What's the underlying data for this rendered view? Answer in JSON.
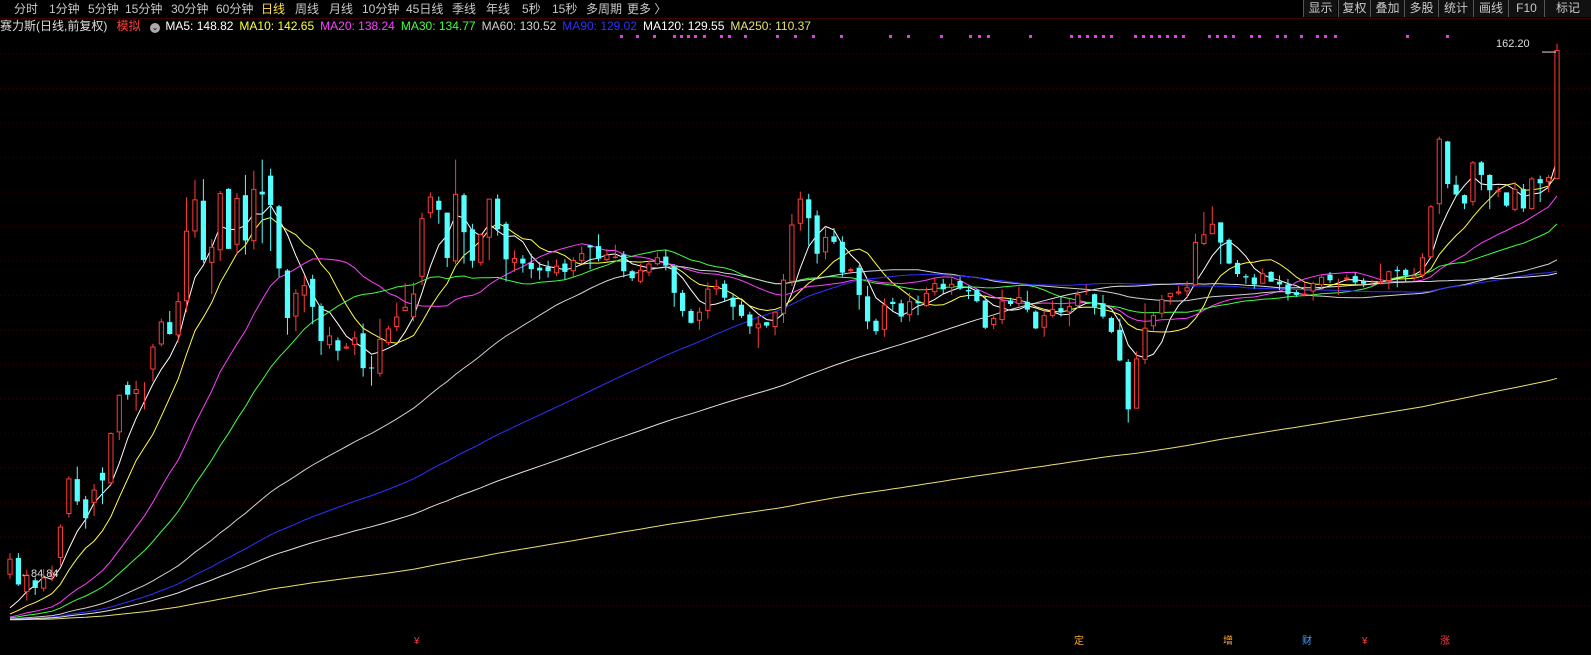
{
  "toolbar": {
    "periods": [
      "分时",
      "1分钟",
      "5分钟",
      "15分钟",
      "30分钟",
      "60分钟",
      "日线",
      "周线",
      "月线",
      "10分钟",
      "45日线",
      "季线",
      "年线",
      "5秒",
      "15秒",
      "多周期",
      "更多 〉"
    ],
    "active_period": "日线",
    "right_buttons": [
      "显示",
      "复权",
      "叠加",
      "多股",
      "统计",
      "画线",
      "F10",
      "标记"
    ]
  },
  "legend": {
    "title": "赛力斯(日线,前复权)",
    "sim": "模拟",
    "ma_items": [
      {
        "name": "MA5",
        "value": "148.82",
        "color": "#ffffff"
      },
      {
        "name": "MA10",
        "value": "142.65",
        "color": "#ffff40"
      },
      {
        "name": "MA20",
        "value": "138.24",
        "color": "#ff40ff"
      },
      {
        "name": "MA30",
        "value": "134.77",
        "color": "#40ff40"
      },
      {
        "name": "MA60",
        "value": "130.52",
        "color": "#d0d0d0"
      },
      {
        "name": "MA90",
        "value": "129.02",
        "color": "#3030ff"
      },
      {
        "name": "MA120",
        "value": "129.55",
        "color": "#ffffff"
      },
      {
        "name": "MA250",
        "value": "110.37",
        "color": "#e8e070"
      }
    ]
  },
  "markers": {
    "high_label": "162.20",
    "low_label": "←84.84"
  },
  "events": [
    "¥",
    "定",
    "增",
    "财",
    "¥",
    "涨"
  ],
  "colors": {
    "up": "#ff3b3b",
    "down": "#54ffff",
    "grid": "#3a0000",
    "background": "#000000",
    "text": "#c8c8c8"
  },
  "chart_data": {
    "type": "candlestick",
    "ylim": [
      80,
      166
    ],
    "candles": [
      [
        88.5,
        90.8,
        91.6,
        87.9
      ],
      [
        90.9,
        87.1,
        91.6,
        86.9
      ],
      [
        86.0,
        88.5,
        89.2,
        84.8
      ],
      [
        87.7,
        86.6,
        88.1,
        85.6
      ],
      [
        86.5,
        88.1,
        89.3,
        86.1
      ],
      [
        88.2,
        88.8,
        89.8,
        87.6
      ],
      [
        90.9,
        95.4,
        95.7,
        89.8
      ],
      [
        97.2,
        102.3,
        102.6,
        96.7
      ],
      [
        102.2,
        99.0,
        104.0,
        98.5
      ],
      [
        99.3,
        96.6,
        99.8,
        95.1
      ],
      [
        98.8,
        100.7,
        101.5,
        96.9
      ],
      [
        103.1,
        102.0,
        103.9,
        98.6
      ],
      [
        101.6,
        108.8,
        108.9,
        101.4
      ],
      [
        108.9,
        114.3,
        114.3,
        107.8
      ],
      [
        115.7,
        114.3,
        116.2,
        113.6
      ],
      [
        114.4,
        115.1,
        116.3,
        112.0
      ],
      [
        114.2,
        114.3,
        116.1,
        112.2
      ],
      [
        117.9,
        121.2,
        121.6,
        116.2
      ],
      [
        121.5,
        124.8,
        125.2,
        121.2
      ],
      [
        124.7,
        123.0,
        126.3,
        122.9
      ],
      [
        122.8,
        127.7,
        129.0,
        121.8
      ],
      [
        127.7,
        137.8,
        142.6,
        126.1
      ],
      [
        137.7,
        142.3,
        145.1,
        136.8
      ],
      [
        142.1,
        133.6,
        145.2,
        133.2
      ],
      [
        133.2,
        135.5,
        136.6,
        128.7
      ],
      [
        135.0,
        143.2,
        143.5,
        133.5
      ],
      [
        143.8,
        135.2,
        143.9,
        135.2
      ],
      [
        135.8,
        142.5,
        143.2,
        134.4
      ],
      [
        142.9,
        136.4,
        145.8,
        134.4
      ],
      [
        136.3,
        143.8,
        146.4,
        135.1
      ],
      [
        143.4,
        143.0,
        148.0,
        136.0
      ],
      [
        145.7,
        141.5,
        146.7,
        134.9
      ],
      [
        141.3,
        132.4,
        141.5,
        131.2
      ],
      [
        132.1,
        125.3,
        132.3,
        122.9
      ],
      [
        125.5,
        128.9,
        129.4,
        123.4
      ],
      [
        128.5,
        130.0,
        131.4,
        126.1
      ],
      [
        130.9,
        126.9,
        131.5,
        124.4
      ],
      [
        127.0,
        122.0,
        127.4,
        120.0
      ],
      [
        121.4,
        122.8,
        124.0,
        120.9
      ],
      [
        122.1,
        120.6,
        122.5,
        119.2
      ],
      [
        120.9,
        121.2,
        121.7,
        120.8
      ],
      [
        121.4,
        122.5,
        123.4,
        120.0
      ],
      [
        123.1,
        118.1,
        124.5,
        116.9
      ],
      [
        118.2,
        118.1,
        119.9,
        115.6
      ],
      [
        117.3,
        122.3,
        125.2,
        116.9
      ],
      [
        121.7,
        123.8,
        124.2,
        121.4
      ],
      [
        124.0,
        125.5,
        127.5,
        123.4
      ],
      [
        126.3,
        126.9,
        130.3,
        126.3
      ],
      [
        125.4,
        128.8,
        130.4,
        124.8
      ],
      [
        131.2,
        139.6,
        140.4,
        130.0
      ],
      [
        140.3,
        142.7,
        143.3,
        139.6
      ],
      [
        142.1,
        140.8,
        142.7,
        138.8
      ],
      [
        140.4,
        133.9,
        140.4,
        132.6
      ],
      [
        133.4,
        143.1,
        148.0,
        133.0
      ],
      [
        142.9,
        137.6,
        143.2,
        133.1
      ],
      [
        138.0,
        133.5,
        138.8,
        132.5
      ],
      [
        133.2,
        137.3,
        137.4,
        132.8
      ],
      [
        136.8,
        142.4,
        142.4,
        133.6
      ],
      [
        142.4,
        138.0,
        143.0,
        137.1
      ],
      [
        138.8,
        133.7,
        139.1,
        130.5
      ],
      [
        133.2,
        133.9,
        135.0,
        131.9
      ],
      [
        133.8,
        133.1,
        134.3,
        131.8
      ],
      [
        133.2,
        132.3,
        134.5,
        131.0
      ],
      [
        132.5,
        132.1,
        133.3,
        130.8
      ],
      [
        132.6,
        132.0,
        133.5,
        131.1
      ],
      [
        131.7,
        132.8,
        133.7,
        131.3
      ],
      [
        133.1,
        131.9,
        133.7,
        130.8
      ],
      [
        132.0,
        133.6,
        134.0,
        131.0
      ],
      [
        133.5,
        134.6,
        135.5,
        133.1
      ],
      [
        135.7,
        135.4,
        135.8,
        132.3
      ],
      [
        135.6,
        133.8,
        137.3,
        133.4
      ],
      [
        133.6,
        134.4,
        135.2,
        133.4
      ],
      [
        133.9,
        134.1,
        135.8,
        133.8
      ],
      [
        134.4,
        132.0,
        134.9,
        131.1
      ],
      [
        132.0,
        131.0,
        132.2,
        130.6
      ],
      [
        130.5,
        132.2,
        133.1,
        130.3
      ],
      [
        131.8,
        133.1,
        133.5,
        131.3
      ],
      [
        133.0,
        134.0,
        134.7,
        132.8
      ],
      [
        134.1,
        132.8,
        135.1,
        132.1
      ],
      [
        132.6,
        128.9,
        133.0,
        126.9
      ],
      [
        128.9,
        126.3,
        129.3,
        125.5
      ],
      [
        126.3,
        124.6,
        126.6,
        124.5
      ],
      [
        124.9,
        126.2,
        126.8,
        123.6
      ],
      [
        126.3,
        129.5,
        130.4,
        125.2
      ],
      [
        129.4,
        129.9,
        130.8,
        128.6
      ],
      [
        130.2,
        128.2,
        130.7,
        127.7
      ],
      [
        128.2,
        126.9,
        128.7,
        125.0
      ],
      [
        127.2,
        125.6,
        127.7,
        125.3
      ],
      [
        125.8,
        124.1,
        126.2,
        123.0
      ],
      [
        123.8,
        124.5,
        125.6,
        121.0
      ],
      [
        124.7,
        124.2,
        124.7,
        123.9
      ],
      [
        124.0,
        126.2,
        126.2,
        122.8
      ],
      [
        125.9,
        130.8,
        131.6,
        124.6
      ],
      [
        130.5,
        138.7,
        140.2,
        129.9
      ],
      [
        138.8,
        142.4,
        143.4,
        137.8
      ],
      [
        142.3,
        139.6,
        143.1,
        135.7
      ],
      [
        140.0,
        134.5,
        140.7,
        133.1
      ],
      [
        134.7,
        136.9,
        138.4,
        133.7
      ],
      [
        137.0,
        136.2,
        138.2,
        135.9
      ],
      [
        136.2,
        131.8,
        137.0,
        131.2
      ],
      [
        132.0,
        132.3,
        132.5,
        131.6
      ],
      [
        132.5,
        128.6,
        132.9,
        126.5
      ],
      [
        128.4,
        124.8,
        129.9,
        123.7
      ],
      [
        124.9,
        123.4,
        125.2,
        122.9
      ],
      [
        123.6,
        127.2,
        128.1,
        122.6
      ],
      [
        127.6,
        127.3,
        128.2,
        126.4
      ],
      [
        127.4,
        125.5,
        127.9,
        124.7
      ],
      [
        125.7,
        127.7,
        128.9,
        124.8
      ],
      [
        127.7,
        127.4,
        128.5,
        125.7
      ],
      [
        127.0,
        128.9,
        129.7,
        126.9
      ],
      [
        129.0,
        130.3,
        131.1,
        128.5
      ],
      [
        130.2,
        129.4,
        130.9,
        128.8
      ],
      [
        129.6,
        130.2,
        131.0,
        128.6
      ],
      [
        130.6,
        129.5,
        131.2,
        129.3
      ],
      [
        129.3,
        129.1,
        129.9,
        128.0
      ],
      [
        129.3,
        127.7,
        129.5,
        127.5
      ],
      [
        127.8,
        123.9,
        128.5,
        123.7
      ],
      [
        124.3,
        125.3,
        125.6,
        123.7
      ],
      [
        125.0,
        127.8,
        129.4,
        124.4
      ],
      [
        127.8,
        127.3,
        128.2,
        127.0
      ],
      [
        127.3,
        128.3,
        129.8,
        126.9
      ],
      [
        127.6,
        126.5,
        129.2,
        126.1
      ],
      [
        126.2,
        123.8,
        126.4,
        123.7
      ],
      [
        123.9,
        125.7,
        126.5,
        122.6
      ],
      [
        125.6,
        126.6,
        127.8,
        125.4
      ],
      [
        126.7,
        126.1,
        128.4,
        125.5
      ],
      [
        126.1,
        127.0,
        128.0,
        124.1
      ],
      [
        127.0,
        128.7,
        129.2,
        126.7
      ],
      [
        128.6,
        128.6,
        130.1,
        128.6
      ],
      [
        128.7,
        126.9,
        128.8,
        125.8
      ],
      [
        127.4,
        125.5,
        128.6,
        125.2
      ],
      [
        125.3,
        123.3,
        125.5,
        123.1
      ],
      [
        123.6,
        119.2,
        125.2,
        119.1
      ],
      [
        119.0,
        112.2,
        119.4,
        110.3
      ],
      [
        112.3,
        119.5,
        120.5,
        112.3
      ],
      [
        119.3,
        123.9,
        127.4,
        118.7
      ],
      [
        124.1,
        125.7,
        126.0,
        123.5
      ],
      [
        125.9,
        128.0,
        128.6,
        125.3
      ],
      [
        128.3,
        128.9,
        128.9,
        127.2
      ],
      [
        128.8,
        129.1,
        129.9,
        128.6
      ],
      [
        129.1,
        129.7,
        130.6,
        128.3
      ],
      [
        130.0,
        136.2,
        137.4,
        130.0
      ],
      [
        135.9,
        137.3,
        140.5,
        135.7
      ],
      [
        137.3,
        138.8,
        141.3,
        137.3
      ],
      [
        139.0,
        136.1,
        139.0,
        133.0
      ],
      [
        136.5,
        133.1,
        136.7,
        133.0
      ],
      [
        133.2,
        131.6,
        133.6,
        131.2
      ],
      [
        131.3,
        131.1,
        131.6,
        130.2
      ],
      [
        131.1,
        130.1,
        131.6,
        129.5
      ],
      [
        130.2,
        131.7,
        132.4,
        130.2
      ],
      [
        131.9,
        130.5,
        132.0,
        130.5
      ],
      [
        130.5,
        130.1,
        131.4,
        129.3
      ],
      [
        130.1,
        128.7,
        130.9,
        127.8
      ],
      [
        129.0,
        128.6,
        129.3,
        128.3
      ],
      [
        128.6,
        128.8,
        130.4,
        128.4
      ],
      [
        129.1,
        130.3,
        130.5,
        127.8
      ],
      [
        130.0,
        131.2,
        131.5,
        129.3
      ],
      [
        131.5,
        130.7,
        131.9,
        130.3
      ],
      [
        130.5,
        130.6,
        130.9,
        128.6
      ],
      [
        130.8,
        131.1,
        131.5,
        130.6
      ],
      [
        131.3,
        130.4,
        131.8,
        130.0
      ],
      [
        130.6,
        130.2,
        131.0,
        129.7
      ],
      [
        130.0,
        130.1,
        130.8,
        129.8
      ],
      [
        130.3,
        130.6,
        133.1,
        130.1
      ],
      [
        130.6,
        132.0,
        132.1,
        129.4
      ],
      [
        132.2,
        132.0,
        132.7,
        129.7
      ],
      [
        132.2,
        131.4,
        132.4,
        130.5
      ],
      [
        131.0,
        131.4,
        132.5,
        130.6
      ],
      [
        131.4,
        134.0,
        134.6,
        131.0
      ],
      [
        134.0,
        141.3,
        141.5,
        133.9
      ],
      [
        141.6,
        151.0,
        151.3,
        140.2
      ],
      [
        150.6,
        144.5,
        150.7,
        143.9
      ],
      [
        144.4,
        143.0,
        145.7,
        142.8
      ],
      [
        142.9,
        141.7,
        143.0,
        140.9
      ],
      [
        141.9,
        147.6,
        147.8,
        141.4
      ],
      [
        147.6,
        145.8,
        147.8,
        143.6
      ],
      [
        145.8,
        143.6,
        145.9,
        140.9
      ],
      [
        143.4,
        143.6,
        144.1,
        142.6
      ],
      [
        143.3,
        141.4,
        143.3,
        141.2
      ],
      [
        140.8,
        143.8,
        144.8,
        140.6
      ],
      [
        143.8,
        141.0,
        144.5,
        140.5
      ],
      [
        140.9,
        145.3,
        145.5,
        140.8
      ],
      [
        145.2,
        144.6,
        145.7,
        141.9
      ],
      [
        144.8,
        145.5,
        145.8,
        143.3
      ],
      [
        145.2,
        163.7,
        164.6,
        145.2
      ]
    ]
  }
}
